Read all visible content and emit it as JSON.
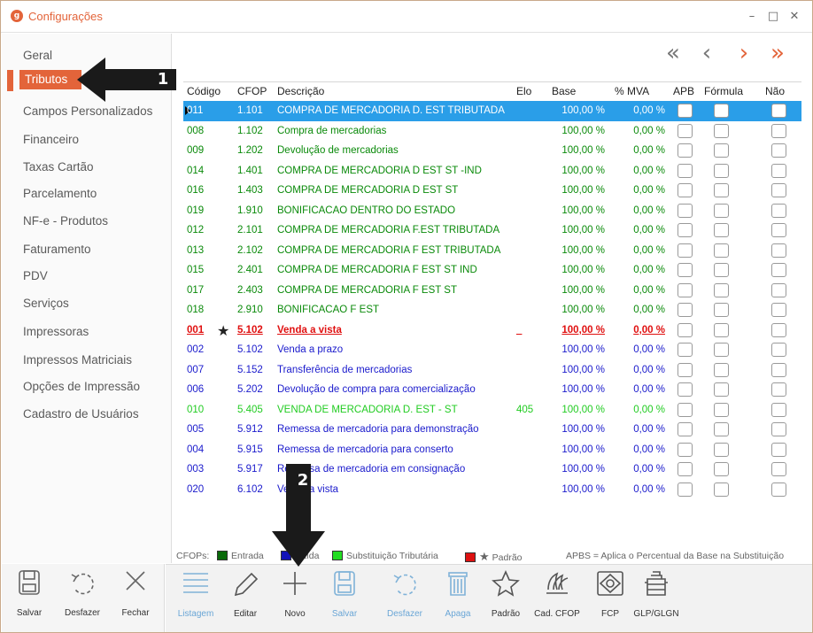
{
  "window": {
    "title": "Configurações",
    "logo_glyph": "g",
    "minimize": "–",
    "maximize": "□",
    "close": "✕"
  },
  "sidebar": {
    "items": [
      {
        "label": "Geral",
        "active": false
      },
      {
        "label": "Tributos",
        "active": true
      },
      {
        "label": "Campos Personalizados",
        "active": false
      },
      {
        "label": "Financeiro",
        "active": false
      },
      {
        "label": "Taxas Cartão",
        "active": false
      },
      {
        "label": "Parcelamento",
        "active": false
      },
      {
        "label": "NF-e - Produtos",
        "active": false
      },
      {
        "label": "Faturamento",
        "active": false
      },
      {
        "label": "PDV",
        "active": false
      },
      {
        "label": "Serviços",
        "active": false
      },
      {
        "label": "Impressoras",
        "active": false
      },
      {
        "label": "Impressos Matriciais",
        "active": false
      },
      {
        "label": "Opções de Impressão",
        "active": false
      },
      {
        "label": "Cadastro de Usuários",
        "active": false
      }
    ]
  },
  "nav": {
    "first": "«",
    "prev": "‹",
    "next": "›",
    "last": "»"
  },
  "grid": {
    "columns": [
      "Código",
      "CFOP",
      "Descrição",
      "Elo",
      "Base",
      "% MVA",
      "APB",
      "Fórmula",
      "Não"
    ],
    "rows": [
      {
        "codigo": "011",
        "cfop": "1.101",
        "descricao": "COMPRA DE MERCADORIA D. EST TRIBUTADA",
        "elo": "",
        "base": "100,00 %",
        "mva": "0,00 %",
        "type": "entrada",
        "selected": true
      },
      {
        "codigo": "008",
        "cfop": "1.102",
        "descricao": "Compra de mercadorias",
        "elo": "",
        "base": "100,00 %",
        "mva": "0,00 %",
        "type": "entrada"
      },
      {
        "codigo": "009",
        "cfop": "1.202",
        "descricao": "Devolução de mercadorias",
        "elo": "",
        "base": "100,00 %",
        "mva": "0,00 %",
        "type": "entrada"
      },
      {
        "codigo": "014",
        "cfop": "1.401",
        "descricao": "COMPRA DE MERCADORIA D EST ST -IND",
        "elo": "",
        "base": "100,00 %",
        "mva": "0,00 %",
        "type": "entrada"
      },
      {
        "codigo": "016",
        "cfop": "1.403",
        "descricao": "COMPRA DE MERCADORIA D EST ST",
        "elo": "",
        "base": "100,00 %",
        "mva": "0,00 %",
        "type": "entrada"
      },
      {
        "codigo": "019",
        "cfop": "1.910",
        "descricao": "BONIFICACAO DENTRO DO ESTADO",
        "elo": "",
        "base": "100,00 %",
        "mva": "0,00 %",
        "type": "entrada"
      },
      {
        "codigo": "012",
        "cfop": "2.101",
        "descricao": "COMPRA DE MERCADORIA F.EST  TRIBUTADA",
        "elo": "",
        "base": "100,00 %",
        "mva": "0,00 %",
        "type": "entrada"
      },
      {
        "codigo": "013",
        "cfop": "2.102",
        "descricao": "COMPRA DE MERCADORIA F EST TRIBUTADA",
        "elo": "",
        "base": "100,00 %",
        "mva": "0,00 %",
        "type": "entrada"
      },
      {
        "codigo": "015",
        "cfop": "2.401",
        "descricao": "COMPRA DE MERCADORIA F EST ST IND",
        "elo": "",
        "base": "100,00 %",
        "mva": "0,00 %",
        "type": "entrada"
      },
      {
        "codigo": "017",
        "cfop": "2.403",
        "descricao": "COMPRA DE MERCADORIA F EST ST",
        "elo": "",
        "base": "100,00 %",
        "mva": "0,00 %",
        "type": "entrada"
      },
      {
        "codigo": "018",
        "cfop": "2.910",
        "descricao": "BONIFICACAO F EST",
        "elo": "",
        "base": "100,00 %",
        "mva": "0,00 %",
        "type": "entrada"
      },
      {
        "codigo": "001",
        "cfop": "5.102",
        "descricao": "Venda a vista",
        "elo": "_",
        "base": "100,00 %",
        "mva": "0,00 %",
        "type": "padrao",
        "star": "★"
      },
      {
        "codigo": "002",
        "cfop": "5.102",
        "descricao": "Venda a prazo",
        "elo": "",
        "base": "100,00 %",
        "mva": "0,00 %",
        "type": "saida"
      },
      {
        "codigo": "007",
        "cfop": "5.152",
        "descricao": "Transferência de mercadorias",
        "elo": "",
        "base": "100,00 %",
        "mva": "0,00 %",
        "type": "saida"
      },
      {
        "codigo": "006",
        "cfop": "5.202",
        "descricao": "Devolução de compra para comercialização",
        "elo": "",
        "base": "100,00 %",
        "mva": "0,00 %",
        "type": "saida"
      },
      {
        "codigo": "010",
        "cfop": "5.405",
        "descricao": "VENDA DE MERCADORIA D. EST - ST",
        "elo": "405",
        "base": "100,00 %",
        "mva": "0,00 %",
        "type": "st"
      },
      {
        "codigo": "005",
        "cfop": "5.912",
        "descricao": "Remessa de mercadoria para demonstração",
        "elo": "",
        "base": "100,00 %",
        "mva": "0,00 %",
        "type": "saida"
      },
      {
        "codigo": "004",
        "cfop": "5.915",
        "descricao": "Remessa de mercadoria para conserto",
        "elo": "",
        "base": "100,00 %",
        "mva": "0,00 %",
        "type": "saida"
      },
      {
        "codigo": "003",
        "cfop": "5.917",
        "descricao": "Remessa de mercadoria em consignação",
        "elo": "",
        "base": "100,00 %",
        "mva": "0,00 %",
        "type": "saida"
      },
      {
        "codigo": "020",
        "cfop": "6.102",
        "descricao": "Venda a vista",
        "elo": "",
        "base": "100,00 %",
        "mva": "0,00 %",
        "type": "saida"
      }
    ]
  },
  "legend": {
    "prefix": "CFOPs:",
    "entrada": "Entrada",
    "saida": "Saída",
    "st": "Substituição Tributária",
    "padrao": "Padrão",
    "apbs_note": "APBS = Aplica o Percentual da Base na Substituição"
  },
  "bottom_left": [
    {
      "label": "Salvar",
      "icon": "save-icon"
    },
    {
      "label": "Desfazer",
      "icon": "undo-icon"
    },
    {
      "label": "Fechar",
      "icon": "close-icon"
    }
  ],
  "toolbar": [
    {
      "label": "Listagem",
      "icon": "list-icon",
      "enabled": false
    },
    {
      "label": "Editar",
      "icon": "pencil-icon",
      "enabled": true
    },
    {
      "label": "Novo",
      "icon": "plus-icon",
      "enabled": true
    },
    {
      "label": "Salvar",
      "icon": "save-icon",
      "enabled": false
    },
    {
      "label": "Desfazer",
      "icon": "undo-icon",
      "enabled": false
    },
    {
      "label": "Apaga",
      "icon": "trash-icon",
      "enabled": false
    },
    {
      "label": "Padrão",
      "icon": "star-icon",
      "enabled": true
    },
    {
      "label": "Cad. CFOP",
      "icon": "cfop-icon",
      "enabled": true
    },
    {
      "label": "FCP",
      "icon": "fcp-icon",
      "enabled": true
    },
    {
      "label": "GLP/GLGN",
      "icon": "gas-cylinder-icon",
      "enabled": true
    }
  ],
  "callouts": {
    "one": "1",
    "two": "2"
  },
  "colors": {
    "accent": "#e3643a",
    "entrada": "#0a8a0a",
    "saida": "#1a1acc",
    "st": "#22cc22",
    "padrao": "#e01010",
    "selected": "#2a9ee8"
  }
}
